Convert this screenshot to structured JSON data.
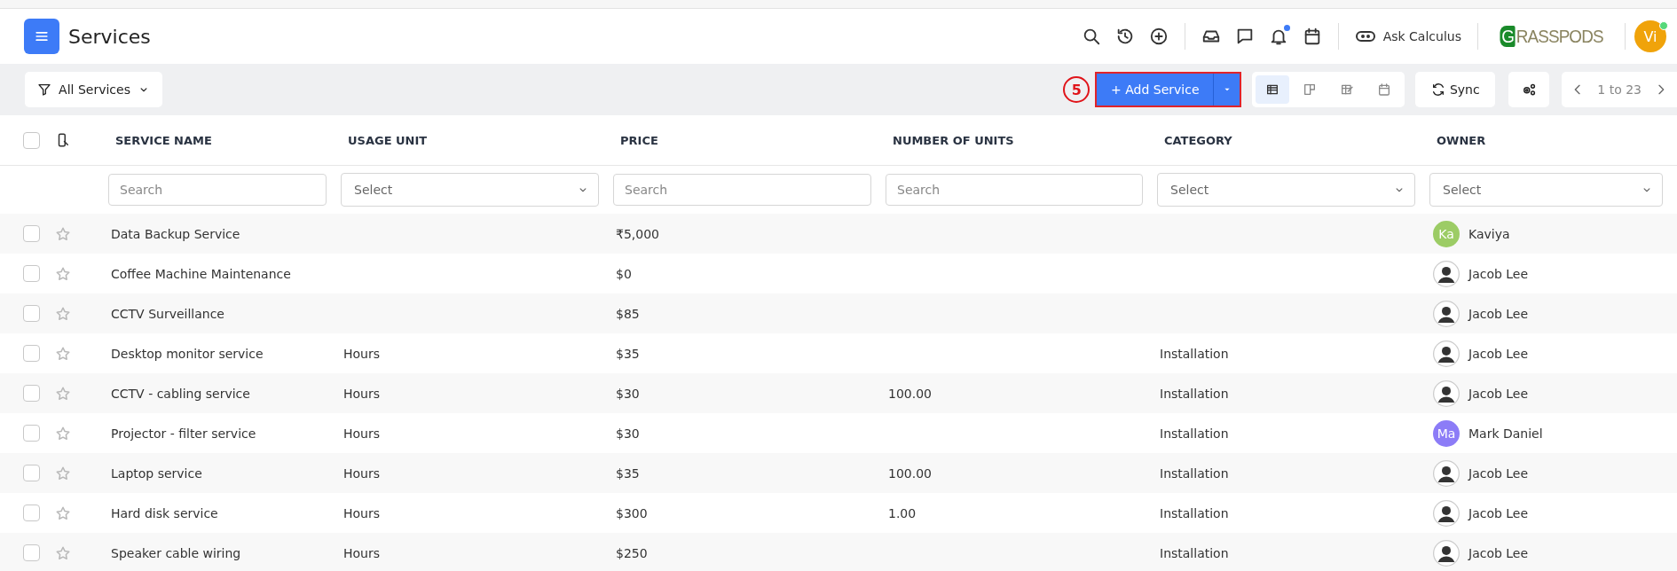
{
  "header": {
    "title": "Services",
    "ask_label": "Ask Calculus",
    "logo": "GRASSPODS",
    "user_avatar": {
      "initials": "Vi",
      "online": true
    },
    "notifications_unread": true
  },
  "toolbar": {
    "filter_label": "All Services",
    "step_badge": "5",
    "add_button": "+ Add Service",
    "views": [
      {
        "kind": "table",
        "selected": true
      },
      {
        "kind": "kanban",
        "selected": false
      },
      {
        "kind": "edit",
        "selected": false
      },
      {
        "kind": "calendar",
        "selected": false
      }
    ],
    "sync_label": "Sync",
    "pagination": "1 to 23"
  },
  "table": {
    "header_checked": false,
    "columns": [
      {
        "label": "SERVICE NAME",
        "filter": {
          "kind": "search",
          "placeholder": "Search"
        }
      },
      {
        "label": "USAGE UNIT",
        "filter": {
          "kind": "select",
          "placeholder": "Select"
        }
      },
      {
        "label": "PRICE",
        "filter": {
          "kind": "search",
          "placeholder": "Search"
        }
      },
      {
        "label": "NUMBER OF UNITS",
        "filter": {
          "kind": "search",
          "placeholder": "Search"
        }
      },
      {
        "label": "CATEGORY",
        "filter": {
          "kind": "select",
          "placeholder": "Select"
        }
      },
      {
        "label": "OWNER",
        "filter": {
          "kind": "select",
          "placeholder": "Select"
        }
      }
    ],
    "rows": [
      {
        "checked": false,
        "starred": false,
        "cells": [
          "Data Backup Service",
          "",
          "₹5,000",
          "",
          ""
        ],
        "owner": {
          "name": "Kaviya",
          "kind": "initials",
          "initials": "Ka",
          "color": "#9ccc65"
        }
      },
      {
        "checked": false,
        "starred": false,
        "cells": [
          "Coffee Machine Maintenance",
          "",
          "$0",
          "",
          ""
        ],
        "owner": {
          "name": "Jacob Lee",
          "kind": "photo"
        }
      },
      {
        "checked": false,
        "starred": false,
        "cells": [
          "CCTV Surveillance",
          "",
          "$85",
          "",
          ""
        ],
        "owner": {
          "name": "Jacob Lee",
          "kind": "photo"
        }
      },
      {
        "checked": false,
        "starred": false,
        "cells": [
          "Desktop monitor service",
          "Hours",
          "$35",
          "",
          "Installation"
        ],
        "owner": {
          "name": "Jacob Lee",
          "kind": "photo"
        }
      },
      {
        "checked": false,
        "starred": false,
        "cells": [
          "CCTV - cabling service",
          "Hours",
          "$30",
          "100.00",
          "Installation"
        ],
        "owner": {
          "name": "Jacob Lee",
          "kind": "photo"
        }
      },
      {
        "checked": false,
        "starred": false,
        "cells": [
          "Projector - filter service",
          "Hours",
          "$30",
          "",
          "Installation"
        ],
        "owner": {
          "name": "Mark Daniel",
          "kind": "initials",
          "initials": "Ma",
          "color": "#8c7cf7"
        }
      },
      {
        "checked": false,
        "starred": false,
        "cells": [
          "Laptop service",
          "Hours",
          "$35",
          "100.00",
          "Installation"
        ],
        "owner": {
          "name": "Jacob Lee",
          "kind": "photo"
        }
      },
      {
        "checked": false,
        "starred": false,
        "cells": [
          "Hard disk service",
          "Hours",
          "$300",
          "1.00",
          "Installation"
        ],
        "owner": {
          "name": "Jacob Lee",
          "kind": "photo"
        }
      },
      {
        "checked": false,
        "starred": false,
        "cells": [
          "Speaker cable wiring",
          "Hours",
          "$250",
          "",
          "Installation"
        ],
        "owner": {
          "name": "Jacob Lee",
          "kind": "photo"
        }
      }
    ]
  }
}
